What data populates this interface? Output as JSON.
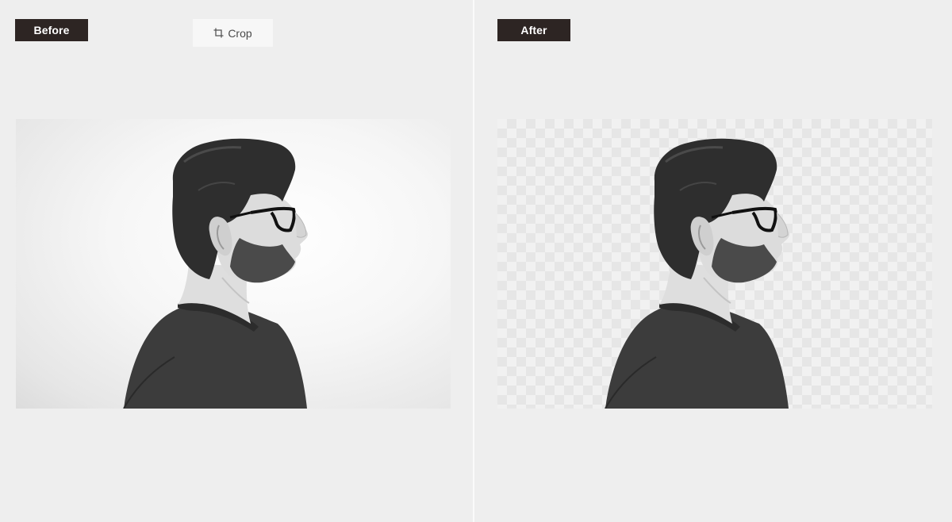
{
  "before_panel": {
    "label": "Before",
    "crop_button": {
      "label": "Crop",
      "icon": "crop-icon"
    }
  },
  "after_panel": {
    "label": "After"
  },
  "colors": {
    "page_background": "#eeeeee",
    "label_background": "#2d2523",
    "label_text": "#ffffff",
    "crop_button_background": "#f7f7f7",
    "divider": "#fafafa"
  }
}
